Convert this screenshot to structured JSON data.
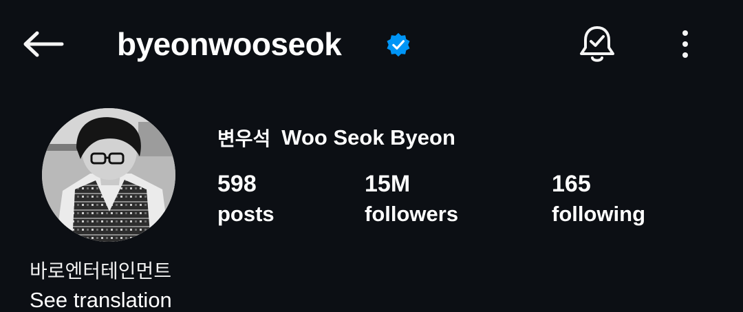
{
  "header": {
    "username": "byeonwooseok",
    "verified": true,
    "verified_color": "#0095f6",
    "back_icon": "arrow-left-icon",
    "bell_icon": "notification-bell-check-icon",
    "more_icon": "more-vertical-icon"
  },
  "profile": {
    "name_korean": "변우석",
    "name_english": "Woo Seok Byeon",
    "avatar": "profile-photo"
  },
  "stats": [
    {
      "value": "598",
      "label": "posts"
    },
    {
      "value": "15M",
      "label": "followers"
    },
    {
      "value": "165",
      "label": "following"
    }
  ],
  "bio": {
    "text": "바로엔터테인먼트",
    "translate_label": "See translation"
  },
  "theme": {
    "background": "#0c0f14",
    "text": "#ffffff"
  }
}
